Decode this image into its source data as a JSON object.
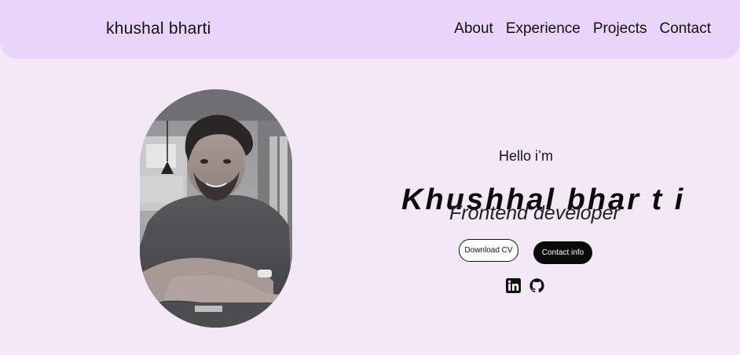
{
  "header": {
    "brand": "khushal bharti",
    "nav": [
      {
        "label": "About"
      },
      {
        "label": "Experience"
      },
      {
        "label": "Projects"
      },
      {
        "label": "Contact"
      }
    ]
  },
  "hero": {
    "greeting": "Hello i’m",
    "name": "Khushhal bhar t i",
    "role": "Frontend developer",
    "buttons": {
      "download_cv": "Download CV",
      "contact_info": "Contact info"
    },
    "socials": [
      {
        "icon": "linkedin-icon"
      },
      {
        "icon": "github-icon"
      }
    ]
  },
  "colors": {
    "background": "#f3e8f5",
    "navbar": "#e8d5f9",
    "primary_button": "#0a0a0a"
  }
}
